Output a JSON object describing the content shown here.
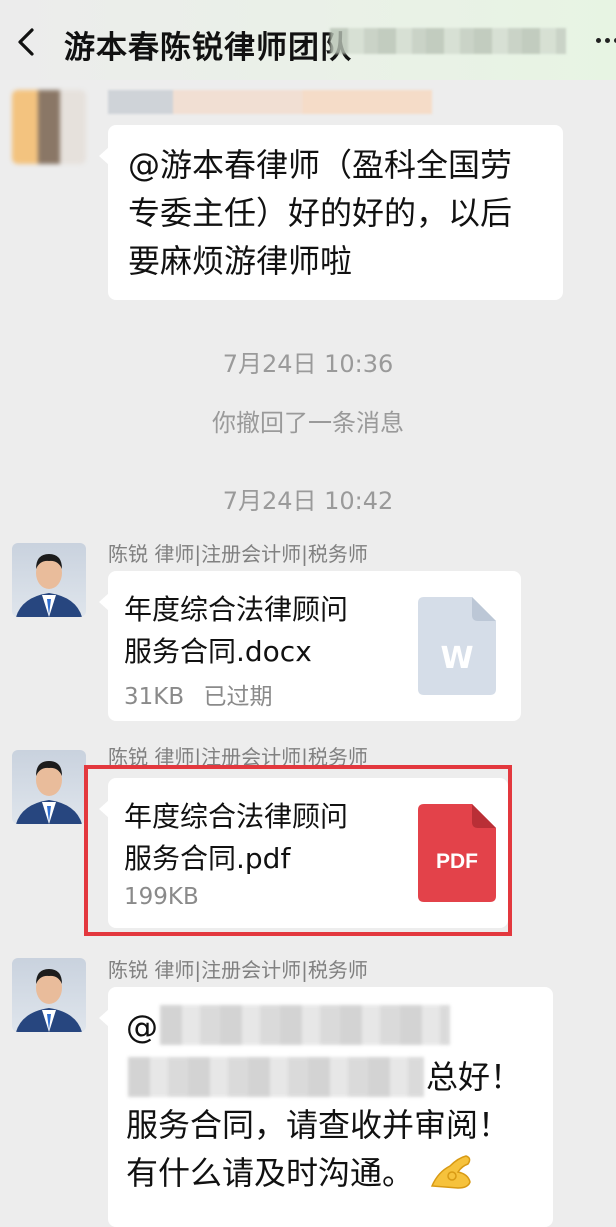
{
  "header": {
    "back_label": "<",
    "title": "游本春陈锐律师团队"
  },
  "messages": {
    "m1": {
      "text": "@游本春律师（盈科全国劳\n专委主任）好的好的，以后\n要麻烦游律师啦"
    },
    "t1": "7月24日 10:36",
    "recall": "你撤回了一条消息",
    "t2": "7月24日 10:42",
    "sender": "陈锐 律师|注册会计师|税务师",
    "file1": {
      "title": "年度综合法律顾问\n服务合同.docx",
      "size": "31KB",
      "status": "已过期",
      "icon_letter": "W",
      "icon_color": "#d5dde8"
    },
    "file2": {
      "title": "年度综合法律顾问\n服务合同.pdf",
      "size": "199KB",
      "icon_label": "PDF",
      "icon_color": "#e3424a"
    },
    "m3": {
      "at": "@",
      "line2_tail": "总好！",
      "line3": "服务合同，请查收并审阅！",
      "line4": "有什么请及时沟通。"
    }
  },
  "colors": {
    "highlight": "#e3383e",
    "background": "#ededed",
    "bubble": "#ffffff"
  },
  "icons": [
    "back-arrow-icon",
    "more-dots-icon",
    "word-file-icon",
    "pdf-file-icon",
    "ok-hand-emoji-icon"
  ]
}
